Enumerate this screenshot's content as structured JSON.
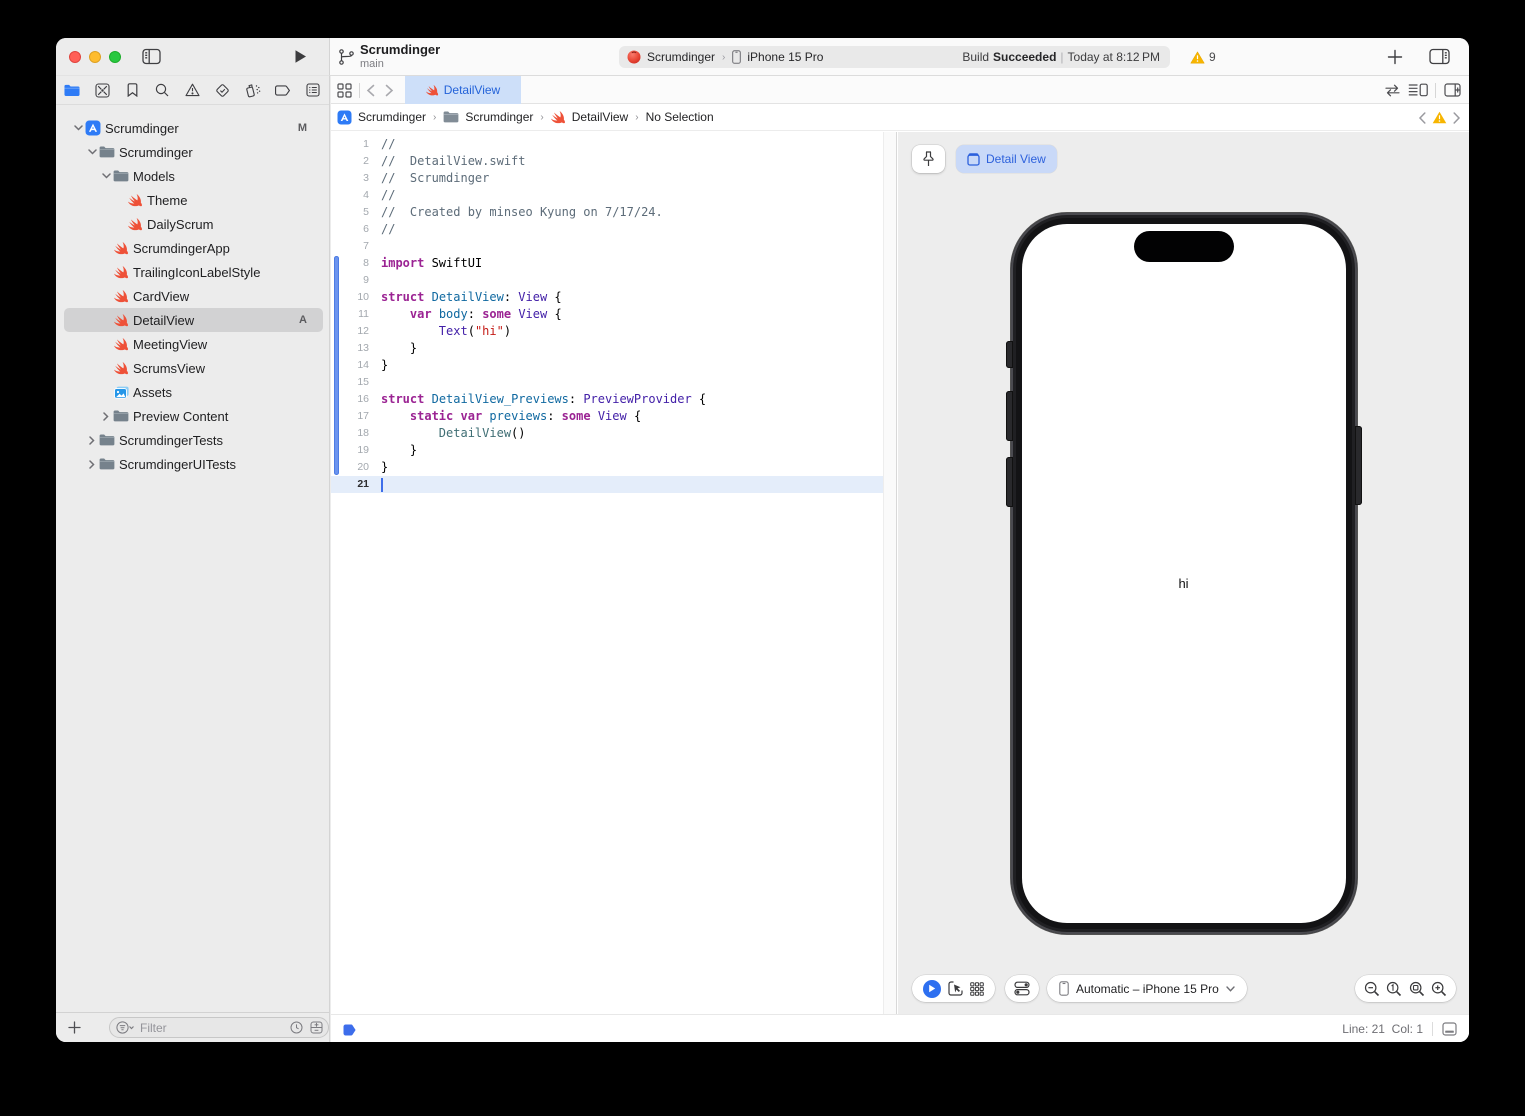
{
  "toolbar": {
    "title": "Scrumdinger",
    "branch": "main",
    "scheme_app": "Scrumdinger",
    "scheme_chevron": "›",
    "scheme_device": "iPhone 15 Pro",
    "status_build": "Build",
    "status_result": "Succeeded",
    "status_sep": "|",
    "status_time": "Today at 8:12 PM",
    "warning_count": "9"
  },
  "navigator_icons": [
    "project-navigator",
    "source-control-navigator",
    "bookmark-navigator",
    "find-navigator",
    "issue-navigator",
    "test-navigator",
    "debug-navigator",
    "breakpoint-navigator",
    "report-navigator"
  ],
  "sidebar": {
    "tree": [
      {
        "label": "Scrumdinger",
        "icon": "project",
        "level": 0,
        "disclosure": "open",
        "badge": "M"
      },
      {
        "label": "Scrumdinger",
        "icon": "folder",
        "level": 1,
        "disclosure": "open"
      },
      {
        "label": "Models",
        "icon": "folder",
        "level": 2,
        "disclosure": "open"
      },
      {
        "label": "Theme",
        "icon": "swift",
        "level": 3
      },
      {
        "label": "DailyScrum",
        "icon": "swift",
        "level": 3
      },
      {
        "label": "ScrumdingerApp",
        "icon": "swift",
        "level": 2
      },
      {
        "label": "TrailingIconLabelStyle",
        "icon": "swift",
        "level": 2
      },
      {
        "label": "CardView",
        "icon": "swift",
        "level": 2
      },
      {
        "label": "DetailView",
        "icon": "swift",
        "level": 2,
        "selected": true,
        "badge": "A"
      },
      {
        "label": "MeetingView",
        "icon": "swift",
        "level": 2
      },
      {
        "label": "ScrumsView",
        "icon": "swift",
        "level": 2
      },
      {
        "label": "Assets",
        "icon": "assets",
        "level": 2
      },
      {
        "label": "Preview Content",
        "icon": "folder",
        "level": 2,
        "disclosure": "closed"
      },
      {
        "label": "ScrumdingerTests",
        "icon": "folder",
        "level": 1,
        "disclosure": "closed"
      },
      {
        "label": "ScrumdingerUITests",
        "icon": "folder",
        "level": 1,
        "disclosure": "closed"
      }
    ],
    "filter_placeholder": "Filter"
  },
  "tabs": {
    "active_label": "DetailView"
  },
  "breadcrumb": {
    "item1": "Scrumdinger",
    "item2": "Scrumdinger",
    "item3": "DetailView",
    "item4": "No Selection"
  },
  "editor": {
    "lines": [
      {
        "n": "1",
        "tokens": [
          [
            "cmt",
            "//"
          ]
        ]
      },
      {
        "n": "2",
        "tokens": [
          [
            "cmt",
            "//  DetailView.swift"
          ]
        ]
      },
      {
        "n": "3",
        "tokens": [
          [
            "cmt",
            "//  Scrumdinger"
          ]
        ]
      },
      {
        "n": "4",
        "tokens": [
          [
            "cmt",
            "//"
          ]
        ]
      },
      {
        "n": "5",
        "tokens": [
          [
            "cmt",
            "//  Created by minseo Kyung on 7/17/24."
          ]
        ]
      },
      {
        "n": "6",
        "tokens": [
          [
            "cmt",
            "//"
          ]
        ]
      },
      {
        "n": "7",
        "tokens": []
      },
      {
        "n": "8",
        "tokens": [
          [
            "kw",
            "import"
          ],
          [
            "pln",
            " SwiftUI"
          ]
        ]
      },
      {
        "n": "9",
        "tokens": []
      },
      {
        "n": "10",
        "tokens": [
          [
            "kw",
            "struct"
          ],
          [
            "pln",
            " "
          ],
          [
            "decl",
            "DetailView"
          ],
          [
            "pln",
            ": "
          ],
          [
            "type",
            "View"
          ],
          [
            "pln",
            " {"
          ]
        ]
      },
      {
        "n": "11",
        "tokens": [
          [
            "pln",
            "    "
          ],
          [
            "kw",
            "var"
          ],
          [
            "pln",
            " "
          ],
          [
            "decl",
            "body"
          ],
          [
            "pln",
            ": "
          ],
          [
            "kw",
            "some"
          ],
          [
            "pln",
            " "
          ],
          [
            "type",
            "View"
          ],
          [
            "pln",
            " {"
          ]
        ]
      },
      {
        "n": "12",
        "tokens": [
          [
            "pln",
            "        "
          ],
          [
            "type",
            "Text"
          ],
          [
            "pln",
            "("
          ],
          [
            "str",
            "\"hi\""
          ],
          [
            "pln",
            ")"
          ]
        ]
      },
      {
        "n": "13",
        "tokens": [
          [
            "pln",
            "    }"
          ]
        ]
      },
      {
        "n": "14",
        "tokens": [
          [
            "pln",
            "}"
          ]
        ]
      },
      {
        "n": "15",
        "tokens": []
      },
      {
        "n": "16",
        "tokens": [
          [
            "kw",
            "struct"
          ],
          [
            "pln",
            " "
          ],
          [
            "decl",
            "DetailView_Previews"
          ],
          [
            "pln",
            ": "
          ],
          [
            "type",
            "PreviewProvider"
          ],
          [
            "pln",
            " {"
          ]
        ]
      },
      {
        "n": "17",
        "tokens": [
          [
            "pln",
            "    "
          ],
          [
            "kw",
            "static"
          ],
          [
            "pln",
            " "
          ],
          [
            "kw",
            "var"
          ],
          [
            "pln",
            " "
          ],
          [
            "decl",
            "previews"
          ],
          [
            "pln",
            ": "
          ],
          [
            "kw",
            "some"
          ],
          [
            "pln",
            " "
          ],
          [
            "type",
            "View"
          ],
          [
            "pln",
            " {"
          ]
        ]
      },
      {
        "n": "18",
        "tokens": [
          [
            "pln",
            "        "
          ],
          [
            "use",
            "DetailView"
          ],
          [
            "pln",
            "()"
          ]
        ]
      },
      {
        "n": "19",
        "tokens": [
          [
            "pln",
            "    }"
          ]
        ]
      },
      {
        "n": "20",
        "tokens": [
          [
            "pln",
            "}"
          ]
        ]
      },
      {
        "n": "21",
        "tokens": [],
        "current": true
      }
    ],
    "changed_lines_start": 8,
    "changed_lines_end": 20
  },
  "preview": {
    "selected_view_label": "Detail View",
    "device_menu_label": "Automatic – iPhone 15 Pro",
    "screen_text": "hi"
  },
  "statusbar": {
    "line_col": "Line: 21  Col: 1"
  },
  "colors": {
    "accent_blue": "#2d6ff0",
    "tab_selected": "#cddff9",
    "warning_yellow": "#f7b500",
    "swift_orange": "#ee5138",
    "keyword": "#9b2393",
    "comment": "#5d6c79",
    "string": "#c41a16",
    "sdk_type": "#4320a8",
    "declaration": "#0f68a0",
    "project_type": "#3f6e74"
  }
}
